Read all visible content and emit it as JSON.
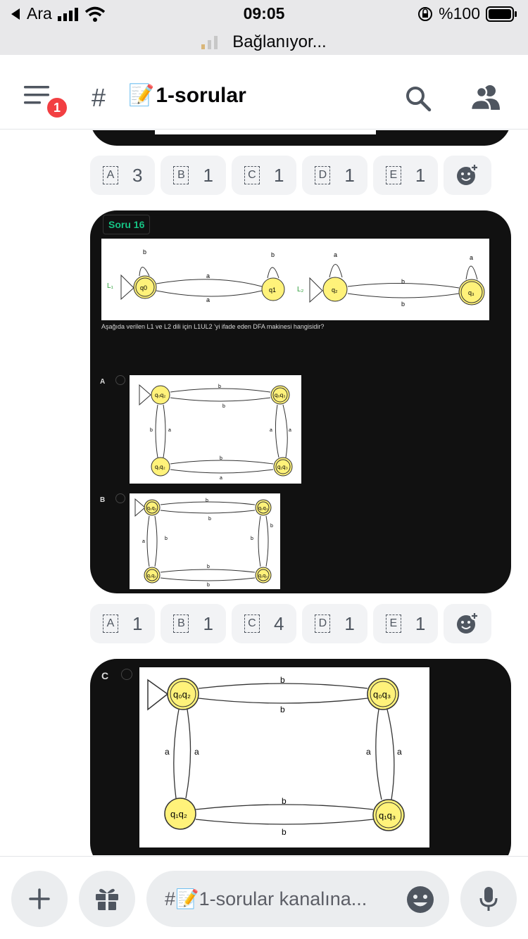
{
  "status": {
    "carrier": "Ara",
    "time": "09:05",
    "battery": "%100",
    "connecting": "Bağlanıyor..."
  },
  "header": {
    "badge_count": "1",
    "channel_name": "1-sorular",
    "channel_emoji": "📝"
  },
  "reactions_top": [
    {
      "key": "A",
      "count": "3"
    },
    {
      "key": "B",
      "count": "1"
    },
    {
      "key": "C",
      "count": "1"
    },
    {
      "key": "D",
      "count": "1"
    },
    {
      "key": "E",
      "count": "1"
    }
  ],
  "question_card": {
    "tag": "Soru 16",
    "question": "Aşağıda verilen L1 ve L2 dili için L1UL2 'yi ifade eden DFA makinesi hangisidir?",
    "options": [
      "A",
      "B"
    ],
    "diagram_labels": {
      "L1": "L₁",
      "L2": "L₂",
      "q0": "q0",
      "q1": "q1",
      "q2": "q₂",
      "q3": "q₃",
      "a": "a",
      "b": "b",
      "q0q2": "q₀q₂",
      "q0q3": "q₀q₃",
      "q1q2": "q₁q₂",
      "q1q3": "q₁q₃"
    }
  },
  "reactions_middle": [
    {
      "key": "A",
      "count": "1"
    },
    {
      "key": "B",
      "count": "1"
    },
    {
      "key": "C",
      "count": "4"
    },
    {
      "key": "D",
      "count": "1"
    },
    {
      "key": "E",
      "count": "1"
    }
  ],
  "option_card": {
    "option": "C"
  },
  "input": {
    "placeholder": "#📝1-sorular kanalına..."
  },
  "colors": {
    "accent_green": "#16c384",
    "badge_red": "#f23f42",
    "state_fill": "#fff27a"
  }
}
